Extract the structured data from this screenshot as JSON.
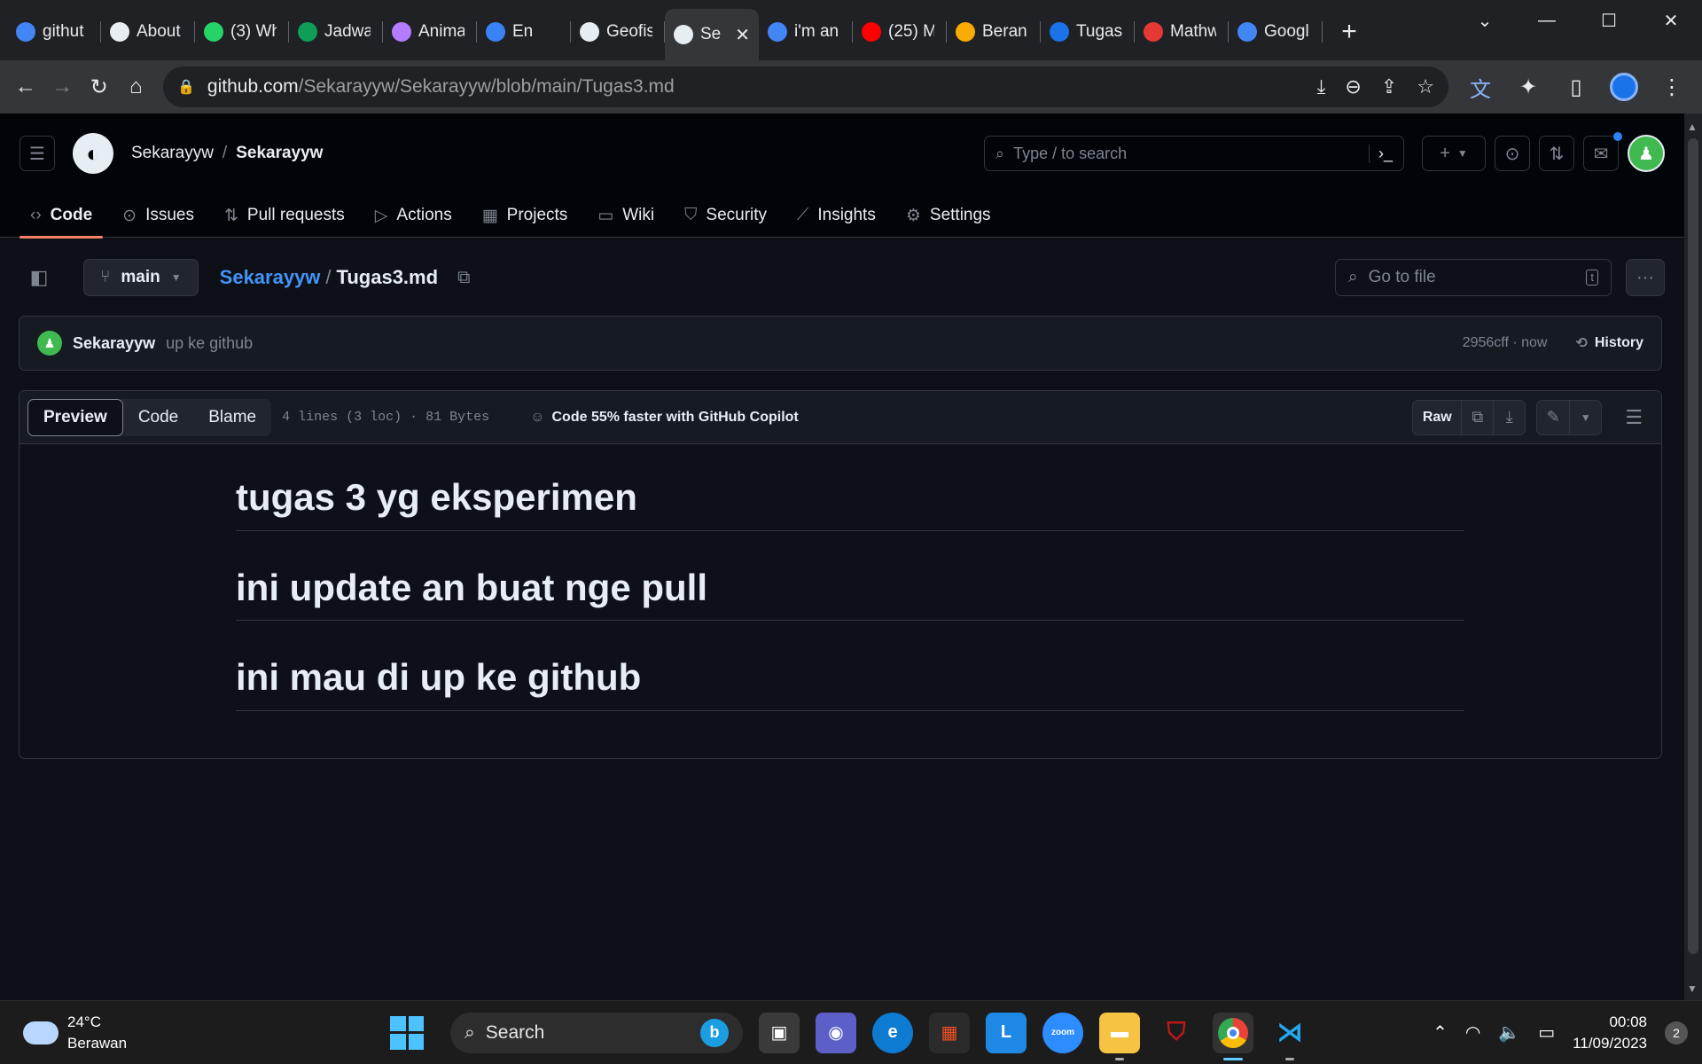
{
  "browser": {
    "tabs": [
      {
        "title": "githut",
        "icon": "google-icon",
        "color": "#4285f4"
      },
      {
        "title": "About",
        "icon": "github-icon",
        "color": "#e6edf3"
      },
      {
        "title": "(3) Wh",
        "icon": "whatsapp-icon",
        "color": "#25d366"
      },
      {
        "title": "Jadwa",
        "icon": "sheets-icon",
        "color": "#0f9d58"
      },
      {
        "title": "Anima",
        "icon": "anima-icon",
        "color": "#b47cff"
      },
      {
        "title": "En",
        "icon": "fx-icon",
        "color": "#3b82f6"
      },
      {
        "title": "Geofis",
        "icon": "github-icon",
        "color": "#e6edf3"
      },
      {
        "title": "Se",
        "icon": "github-icon",
        "color": "#e6edf3",
        "active": true
      },
      {
        "title": "i'm an",
        "icon": "google-icon",
        "color": "#4285f4"
      },
      {
        "title": "(25) M",
        "icon": "youtube-icon",
        "color": "#ff0000"
      },
      {
        "title": "Beran",
        "icon": "classroom-icon",
        "color": "#f9ab00"
      },
      {
        "title": "Tugas",
        "icon": "classroom-icon",
        "color": "#1a73e8"
      },
      {
        "title": "Mathw",
        "icon": "mathway-icon",
        "color": "#e53935"
      },
      {
        "title": "Googl",
        "icon": "translate-icon",
        "color": "#4285f4"
      }
    ],
    "url_host": "github.com",
    "url_path": "/Sekarayyw/Sekarayyw/blob/main/Tugas3.md"
  },
  "github": {
    "owner": "Sekarayyw",
    "repo": "Sekarayyw",
    "search_placeholder": "Type / to search",
    "search_key": "/",
    "nav": [
      {
        "label": "Code",
        "icon": "code-icon",
        "active": true
      },
      {
        "label": "Issues",
        "icon": "issue-icon"
      },
      {
        "label": "Pull requests",
        "icon": "pull-request-icon"
      },
      {
        "label": "Actions",
        "icon": "play-icon"
      },
      {
        "label": "Projects",
        "icon": "table-icon"
      },
      {
        "label": "Wiki",
        "icon": "book-icon"
      },
      {
        "label": "Security",
        "icon": "shield-icon"
      },
      {
        "label": "Insights",
        "icon": "graph-icon"
      },
      {
        "label": "Settings",
        "icon": "gear-icon"
      }
    ],
    "branch": "main",
    "path_repo": "Sekarayyw",
    "path_file": "Tugas3.md",
    "goto_placeholder": "Go to file",
    "goto_key": "t",
    "commit": {
      "author": "Sekarayyw",
      "message": "up ke github",
      "meta": "2956cff · now",
      "history_label": "History"
    },
    "viewer": {
      "tabs": [
        "Preview",
        "Code",
        "Blame"
      ],
      "file_info": "4 lines (3 loc) · 81 Bytes",
      "copilot": "Code 55% faster with GitHub Copilot",
      "raw_label": "Raw"
    },
    "content": [
      "tugas 3 yg eksperimen",
      "ini update an buat nge pull",
      "ini mau di up ke github"
    ]
  },
  "taskbar": {
    "temp": "24°C",
    "weather": "Berawan",
    "search_label": "Search",
    "time": "00:08",
    "date": "11/09/2023",
    "notifications": "2"
  },
  "colors": {
    "accent": "#f78166",
    "link": "#4493f8",
    "bg": "#0d1117"
  }
}
